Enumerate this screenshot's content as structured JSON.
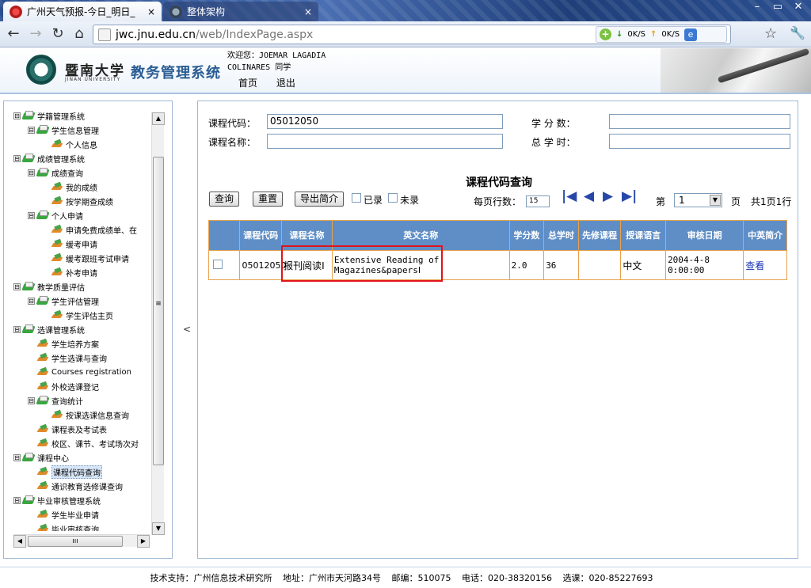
{
  "browser": {
    "tabs": [
      {
        "label": "广州天气预报-今日_明日_",
        "close": "×",
        "active": true
      },
      {
        "label": "整体架构",
        "close": "×",
        "active": false
      }
    ],
    "url_host": "jwc.jnu.edu.cn",
    "url_path": "/web/IndexPage.aspx",
    "down_speed": "0K/S",
    "up_speed": "0K/S"
  },
  "header": {
    "university": "暨南大学",
    "university_en": "JINAN UNIVERSITY",
    "system_title": "教务管理系统",
    "welcome": "欢迎您：JOEMAR LAGADIA",
    "user_line": "COLINARES 同学",
    "home_link": "首页",
    "logout_link": "退出"
  },
  "tree": [
    {
      "indent": 0,
      "exp": "⊟",
      "icon": "folder",
      "label": "学籍管理系统"
    },
    {
      "indent": 1,
      "exp": "⊟",
      "icon": "folder",
      "label": "学生信息管理"
    },
    {
      "indent": 2,
      "exp": "",
      "icon": "leaf",
      "label": "个人信息"
    },
    {
      "indent": 0,
      "exp": "⊟",
      "icon": "folder",
      "label": "成绩管理系统"
    },
    {
      "indent": 1,
      "exp": "⊟",
      "icon": "folder",
      "label": "成绩查询"
    },
    {
      "indent": 2,
      "exp": "",
      "icon": "leaf",
      "label": "我的成绩"
    },
    {
      "indent": 2,
      "exp": "",
      "icon": "leaf",
      "label": "按学期查成绩"
    },
    {
      "indent": 1,
      "exp": "⊟",
      "icon": "folder",
      "label": "个人申请"
    },
    {
      "indent": 2,
      "exp": "",
      "icon": "leaf",
      "label": "申请免费成绩单、在"
    },
    {
      "indent": 2,
      "exp": "",
      "icon": "leaf",
      "label": "缓考申请"
    },
    {
      "indent": 2,
      "exp": "",
      "icon": "leaf",
      "label": "缓考跟班考试申请"
    },
    {
      "indent": 2,
      "exp": "",
      "icon": "leaf",
      "label": "补考申请"
    },
    {
      "indent": 0,
      "exp": "⊟",
      "icon": "folder",
      "label": "教学质量评估"
    },
    {
      "indent": 1,
      "exp": "⊟",
      "icon": "folder",
      "label": "学生评估管理"
    },
    {
      "indent": 2,
      "exp": "",
      "icon": "leaf",
      "label": "学生评估主页"
    },
    {
      "indent": 0,
      "exp": "⊟",
      "icon": "folder",
      "label": "选课管理系统"
    },
    {
      "indent": 1,
      "exp": "",
      "icon": "leaf",
      "label": "学生培养方案"
    },
    {
      "indent": 1,
      "exp": "",
      "icon": "leaf",
      "label": "学生选课与查询"
    },
    {
      "indent": 1,
      "exp": "",
      "icon": "leaf",
      "label": "Courses registration"
    },
    {
      "indent": 1,
      "exp": "",
      "icon": "leaf",
      "label": "外校选课登记"
    },
    {
      "indent": 1,
      "exp": "⊟",
      "icon": "folder",
      "label": "查询统计"
    },
    {
      "indent": 2,
      "exp": "",
      "icon": "leaf",
      "label": "按课选课信息查询"
    },
    {
      "indent": 1,
      "exp": "",
      "icon": "leaf",
      "label": "课程表及考试表"
    },
    {
      "indent": 1,
      "exp": "",
      "icon": "leaf",
      "label": "校区、课节、考试场次对"
    },
    {
      "indent": 0,
      "exp": "⊟",
      "icon": "folder",
      "label": "课程中心"
    },
    {
      "indent": 1,
      "exp": "",
      "icon": "leaf",
      "label": "课程代码查询",
      "selected": true
    },
    {
      "indent": 1,
      "exp": "",
      "icon": "leaf",
      "label": "通识教育选修课查询"
    },
    {
      "indent": 0,
      "exp": "⊟",
      "icon": "folder",
      "label": "毕业审核管理系统"
    },
    {
      "indent": 1,
      "exp": "",
      "icon": "leaf",
      "label": "学生毕业申请"
    },
    {
      "indent": 1,
      "exp": "",
      "icon": "leaf",
      "label": "毕业审核查询"
    }
  ],
  "scrollbar": {
    "thumb_grip": "≡",
    "h_grip": "ııı"
  },
  "collapse_arrow": "<",
  "form": {
    "course_code_label": "课程代码：",
    "course_code_value": "05012050",
    "course_name_label": "课程名称：",
    "course_name_value": "",
    "credits_label": "学 分 数：",
    "credits_value": "",
    "hours_label": "总 学 时：",
    "hours_value": ""
  },
  "query": {
    "title": "课程代码查询",
    "btn_query": "查询",
    "btn_reset": "重置",
    "btn_export": "导出简介",
    "recorded": "已录",
    "not_recorded": "未录",
    "per_page_label": "每页行数：",
    "per_page_value": "15",
    "page_prefix": "第",
    "page_value": "1",
    "page_suffix": "页",
    "page_summary": "共1页1行"
  },
  "table": {
    "headers": [
      "",
      "课程代码",
      "课程名称",
      "英文名称",
      "学分数",
      "总学时",
      "先修课程",
      "授课语言",
      "审核日期",
      "中英简介"
    ],
    "rows": [
      {
        "code": "05012050",
        "name": "报刊阅读Ⅰ",
        "english": "Extensive Reading of Magazines&papersⅠ",
        "credits": "2.0",
        "hours": "36",
        "prereq": "",
        "language": "中文",
        "date": "2004-4-8 0:00:00",
        "intro": "查看"
      }
    ]
  },
  "footer": {
    "support": "技术支持：广州信息技术研究所",
    "address": "地址：广州市天河路34号",
    "postcode": "邮编：510075",
    "phone": "电话：020-38320156",
    "course_phone": "选课：020-85227693"
  }
}
